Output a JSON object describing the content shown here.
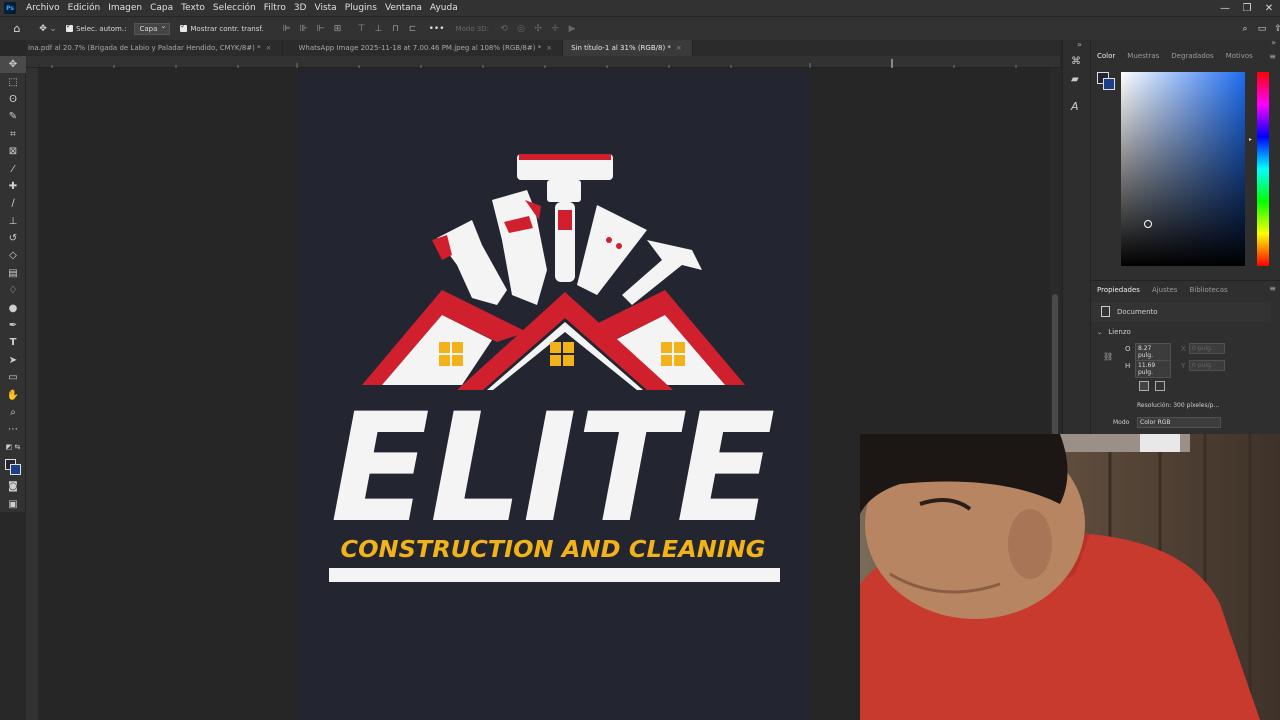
{
  "app": {
    "logo_text": "Ps"
  },
  "menu": [
    "Archivo",
    "Edición",
    "Imagen",
    "Capa",
    "Texto",
    "Selección",
    "Filtro",
    "3D",
    "Vista",
    "Plugins",
    "Ventana",
    "Ayuda"
  ],
  "options": {
    "auto_select_label": "Selec. autom.:",
    "auto_select_value": "Capa",
    "show_transform_label": "Mostrar contr. transf.",
    "mode_3d_label": "Modo 3D:"
  },
  "tabs": [
    {
      "label": "ina.pdf al 20.7% (Brigada de  Labio y Paladar Hendido, CMYK/8#) *",
      "active": false
    },
    {
      "label": "WhatsApp Image 2025-11-18 at 7.00.46 PM.jpeg al 108% (RGB/8#) *",
      "active": false
    },
    {
      "label": "Sin título-1 al 31% (RGB/8) *",
      "active": true
    }
  ],
  "artwork": {
    "headline": "ELITE",
    "tagline": "CONSTRUCTION AND CLEANING",
    "colors": {
      "background": "#232630",
      "red": "#d0202e",
      "white": "#f4f4f4",
      "gold": "#f2b21a"
    }
  },
  "color_panel": {
    "tabs": [
      "Color",
      "Muestras",
      "Degradados",
      "Motivos"
    ],
    "active_tab": "Color"
  },
  "properties_panel": {
    "tabs": [
      "Propiedades",
      "Ajustes",
      "Bibliotecas"
    ],
    "active_tab": "Propiedades",
    "doc_label": "Documento",
    "section": "Lienzo",
    "width_label": "O",
    "width_value": "8.27 pulg.",
    "height_label": "H",
    "height_value": "11.69 pulg.",
    "x_label": "X",
    "x_value": "0 pulg.",
    "y_label": "Y",
    "y_value": "0 pulg.",
    "resolution": "Resolución: 300 píxeles/p...",
    "mode_label": "Modo",
    "mode_value": "Color RGB"
  }
}
